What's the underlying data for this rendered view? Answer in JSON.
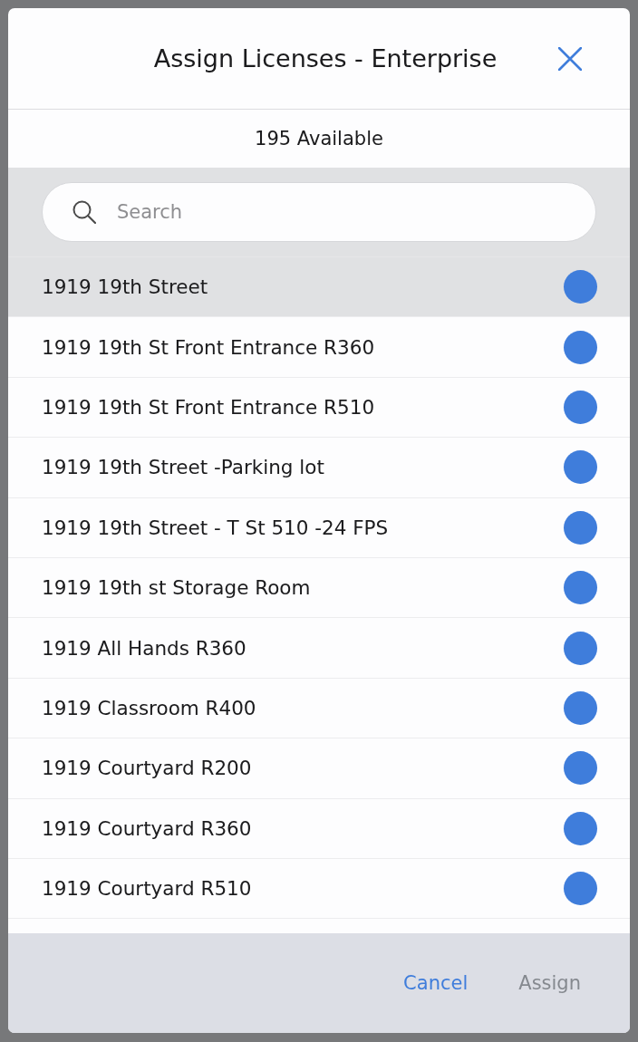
{
  "dialog": {
    "title": "Assign Licenses - Enterprise",
    "available": "195 Available"
  },
  "search": {
    "placeholder": "Search"
  },
  "rows": [
    {
      "label": "1919 19th Street",
      "selected": true,
      "checked": true
    },
    {
      "label": "1919 19th St Front Entrance R360",
      "selected": false,
      "checked": true
    },
    {
      "label": "1919 19th St Front Entrance R510",
      "selected": false,
      "checked": true
    },
    {
      "label": "1919 19th Street -Parking lot",
      "selected": false,
      "checked": true
    },
    {
      "label": "1919 19th Street - T St 510 -24 FPS",
      "selected": false,
      "checked": true
    },
    {
      "label": "1919 19th st Storage Room",
      "selected": false,
      "checked": true
    },
    {
      "label": "1919 All Hands R360",
      "selected": false,
      "checked": true
    },
    {
      "label": "1919 Classroom R400",
      "selected": false,
      "checked": true
    },
    {
      "label": "1919 Courtyard R200",
      "selected": false,
      "checked": true
    },
    {
      "label": "1919 Courtyard R360",
      "selected": false,
      "checked": true
    },
    {
      "label": "1919 Courtyard R510",
      "selected": false,
      "checked": true
    }
  ],
  "buttons": [
    {
      "label": "Cancel",
      "disabled": false
    },
    {
      "label": "Assign",
      "disabled": true
    }
  ]
}
